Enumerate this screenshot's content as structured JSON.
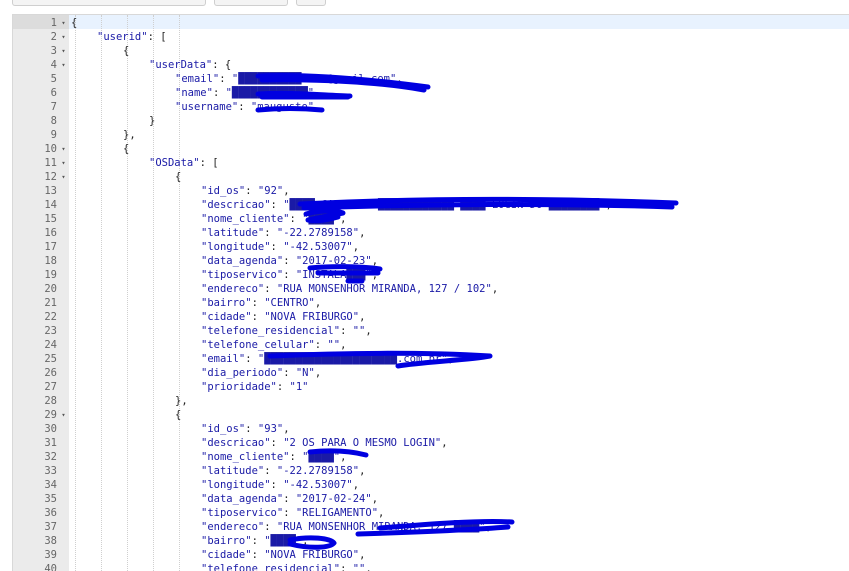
{
  "toolbar": {
    "buttons": [
      "",
      "",
      ""
    ]
  },
  "editor": {
    "lines": [
      {
        "n": "1",
        "fold": "▾",
        "indent": 0,
        "key": "",
        "val": "",
        "tail": "{"
      },
      {
        "n": "2",
        "fold": "▾",
        "indent": 1,
        "key": "\"userid\"",
        "val": "",
        "tail": ": ["
      },
      {
        "n": "3",
        "fold": "▾",
        "indent": 2,
        "key": "",
        "val": "",
        "tail": "{"
      },
      {
        "n": "4",
        "fold": "▾",
        "indent": 3,
        "key": "\"userData\"",
        "val": "",
        "tail": ": {"
      },
      {
        "n": "5",
        "fold": "",
        "indent": 4,
        "key": "\"email\"",
        "val": "\"██████████ilva@gmail.com\"",
        "tail": ","
      },
      {
        "n": "6",
        "fold": "",
        "indent": 4,
        "key": "\"name\"",
        "val": "\"████████████\"",
        "tail": ","
      },
      {
        "n": "7",
        "fold": "",
        "indent": 4,
        "key": "\"username\"",
        "val": "\"maugusto\"",
        "tail": ""
      },
      {
        "n": "8",
        "fold": "",
        "indent": 3,
        "key": "",
        "val": "",
        "tail": "}"
      },
      {
        "n": "9",
        "fold": "",
        "indent": 2,
        "key": "",
        "val": "",
        "tail": "},"
      },
      {
        "n": "10",
        "fold": "▾",
        "indent": 2,
        "key": "",
        "val": "",
        "tail": "{"
      },
      {
        "n": "11",
        "fold": "▾",
        "indent": 3,
        "key": "\"OSData\"",
        "val": "",
        "tail": ": ["
      },
      {
        "n": "12",
        "fold": "▾",
        "indent": 4,
        "key": "",
        "val": "",
        "tail": "{"
      },
      {
        "n": "13",
        "fold": "",
        "indent": 5,
        "key": "\"id_os\"",
        "val": "\"92\"",
        "tail": ","
      },
      {
        "n": "14",
        "fold": "",
        "indent": 5,
        "key": "\"descricao\"",
        "val": "\"████ CADASTRO ████████████ ████ LOGIN DO ████████\"",
        "tail": ","
      },
      {
        "n": "15",
        "fold": "",
        "indent": 5,
        "key": "\"nome_cliente\"",
        "val": "\"████\"",
        "tail": ","
      },
      {
        "n": "16",
        "fold": "",
        "indent": 5,
        "key": "\"latitude\"",
        "val": "\"-22.2789158\"",
        "tail": ","
      },
      {
        "n": "17",
        "fold": "",
        "indent": 5,
        "key": "\"longitude\"",
        "val": "\"-42.53007\"",
        "tail": ","
      },
      {
        "n": "18",
        "fold": "",
        "indent": 5,
        "key": "\"data_agenda\"",
        "val": "\"2017-02-23\"",
        "tail": ","
      },
      {
        "n": "19",
        "fold": "",
        "indent": 5,
        "key": "\"tiposervico\"",
        "val": "\"INSTALA███\"",
        "tail": ","
      },
      {
        "n": "20",
        "fold": "",
        "indent": 5,
        "key": "\"endereco\"",
        "val": "\"RUA MONSENHOR MIRANDA, 127 / 102\"",
        "tail": ","
      },
      {
        "n": "21",
        "fold": "",
        "indent": 5,
        "key": "\"bairro\"",
        "val": "\"CENTRO\"",
        "tail": ","
      },
      {
        "n": "22",
        "fold": "",
        "indent": 5,
        "key": "\"cidade\"",
        "val": "\"NOVA FRIBURGO\"",
        "tail": ","
      },
      {
        "n": "23",
        "fold": "",
        "indent": 5,
        "key": "\"telefone_residencial\"",
        "val": "\"\"",
        "tail": ","
      },
      {
        "n": "24",
        "fold": "",
        "indent": 5,
        "key": "\"telefone_celular\"",
        "val": "\"\"",
        "tail": ","
      },
      {
        "n": "25",
        "fold": "",
        "indent": 5,
        "key": "\"email\"",
        "val": "\"█████████████████████.com.br\"",
        "tail": ","
      },
      {
        "n": "26",
        "fold": "",
        "indent": 5,
        "key": "\"dia_periodo\"",
        "val": "\"N\"",
        "tail": ","
      },
      {
        "n": "27",
        "fold": "",
        "indent": 5,
        "key": "\"prioridade\"",
        "val": "\"1\"",
        "tail": ""
      },
      {
        "n": "28",
        "fold": "",
        "indent": 4,
        "key": "",
        "val": "",
        "tail": "},"
      },
      {
        "n": "29",
        "fold": "▾",
        "indent": 4,
        "key": "",
        "val": "",
        "tail": "{"
      },
      {
        "n": "30",
        "fold": "",
        "indent": 5,
        "key": "\"id_os\"",
        "val": "\"93\"",
        "tail": ","
      },
      {
        "n": "31",
        "fold": "",
        "indent": 5,
        "key": "\"descricao\"",
        "val": "\"2 OS PARA O MESMO LOGIN\"",
        "tail": ","
      },
      {
        "n": "32",
        "fold": "",
        "indent": 5,
        "key": "\"nome_cliente\"",
        "val": "\"████\"",
        "tail": ","
      },
      {
        "n": "33",
        "fold": "",
        "indent": 5,
        "key": "\"latitude\"",
        "val": "\"-22.2789158\"",
        "tail": ","
      },
      {
        "n": "34",
        "fold": "",
        "indent": 5,
        "key": "\"longitude\"",
        "val": "\"-42.53007\"",
        "tail": ","
      },
      {
        "n": "35",
        "fold": "",
        "indent": 5,
        "key": "\"data_agenda\"",
        "val": "\"2017-02-24\"",
        "tail": ","
      },
      {
        "n": "36",
        "fold": "",
        "indent": 5,
        "key": "\"tiposervico\"",
        "val": "\"RELIGAMENTO\"",
        "tail": ","
      },
      {
        "n": "37",
        "fold": "",
        "indent": 5,
        "key": "\"endereco\"",
        "val": "\"RUA MONSENHOR MIRANDA, 127 ████\"",
        "tail": ","
      },
      {
        "n": "38",
        "fold": "",
        "indent": 5,
        "key": "\"bairro\"",
        "val": "\"████\"",
        "tail": ","
      },
      {
        "n": "39",
        "fold": "",
        "indent": 5,
        "key": "\"cidade\"",
        "val": "\"NOVA FRIBURGO\"",
        "tail": ","
      },
      {
        "n": "40",
        "fold": "",
        "indent": 5,
        "key": "\"telefone_residencial\"",
        "val": "\"\"",
        "tail": ","
      }
    ]
  },
  "colors": {
    "gutter_bg": "#ebebeb",
    "active_line": "#e8f2fe",
    "string_color": "#1a1aa6",
    "redaction_ink": "#0000e0"
  }
}
